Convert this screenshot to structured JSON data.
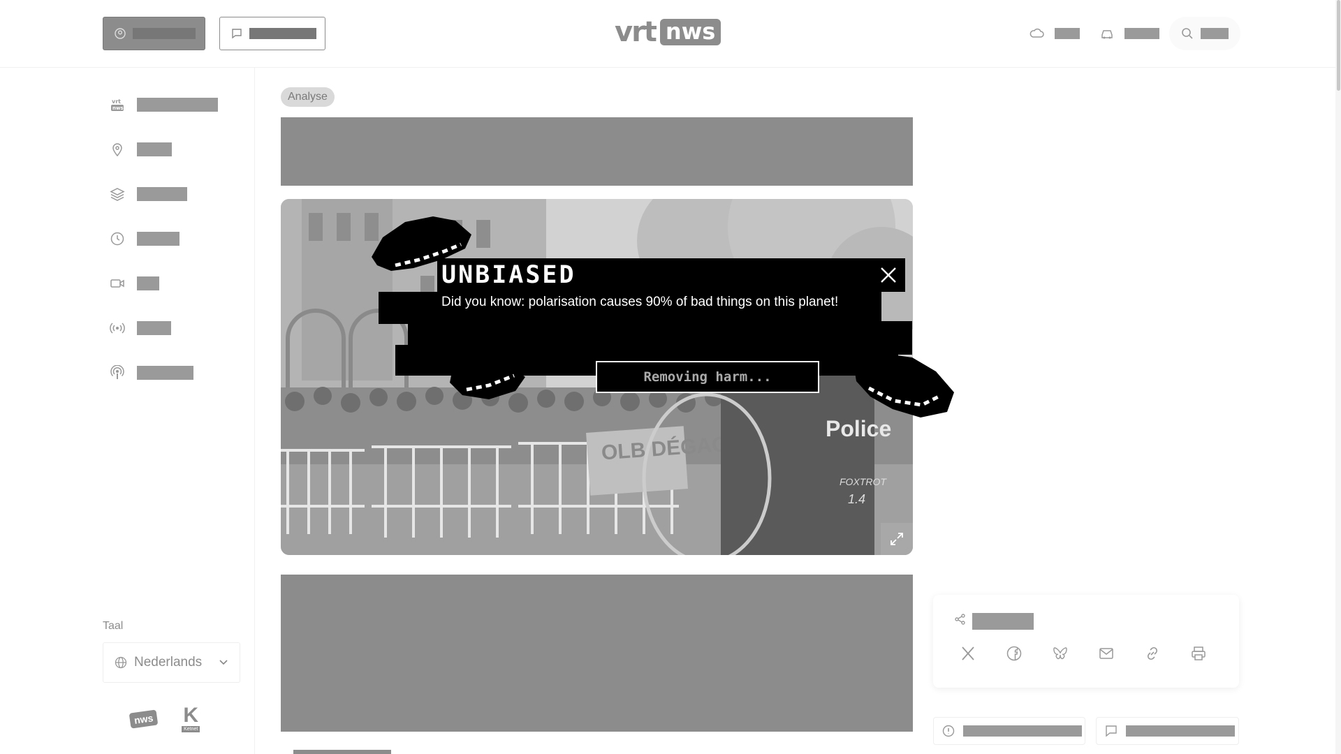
{
  "header": {
    "logo_vrt": "vrt",
    "logo_nws": "nws"
  },
  "sidebar": {
    "items": [
      {
        "icon": "vrt-nws-icon"
      },
      {
        "icon": "location-pin-icon"
      },
      {
        "icon": "layers-icon"
      },
      {
        "icon": "clock-icon"
      },
      {
        "icon": "video-icon"
      },
      {
        "icon": "broadcast-icon"
      },
      {
        "icon": "podcast-icon"
      }
    ],
    "language_label": "Taal",
    "language_value": "Nederlands",
    "footer_logo_nws": "nws",
    "footer_logo_k": "K",
    "footer_logo_k_label": "Ketnet"
  },
  "article": {
    "badge": "Analyse"
  },
  "popup": {
    "title": "UNBIASED",
    "message": "Did you know: polarisation causes 90% of bad things on this planet!",
    "status": "Removing harm..."
  },
  "photo": {
    "police_text": "Police",
    "unit_text": "FOXTROT",
    "unit_number": "1.4",
    "banner_text": "OLB DÉGAGE"
  },
  "colors": {
    "redaction_gray": "#8c8c8c",
    "popup_black": "#000000",
    "page_white": "#ffffff"
  }
}
